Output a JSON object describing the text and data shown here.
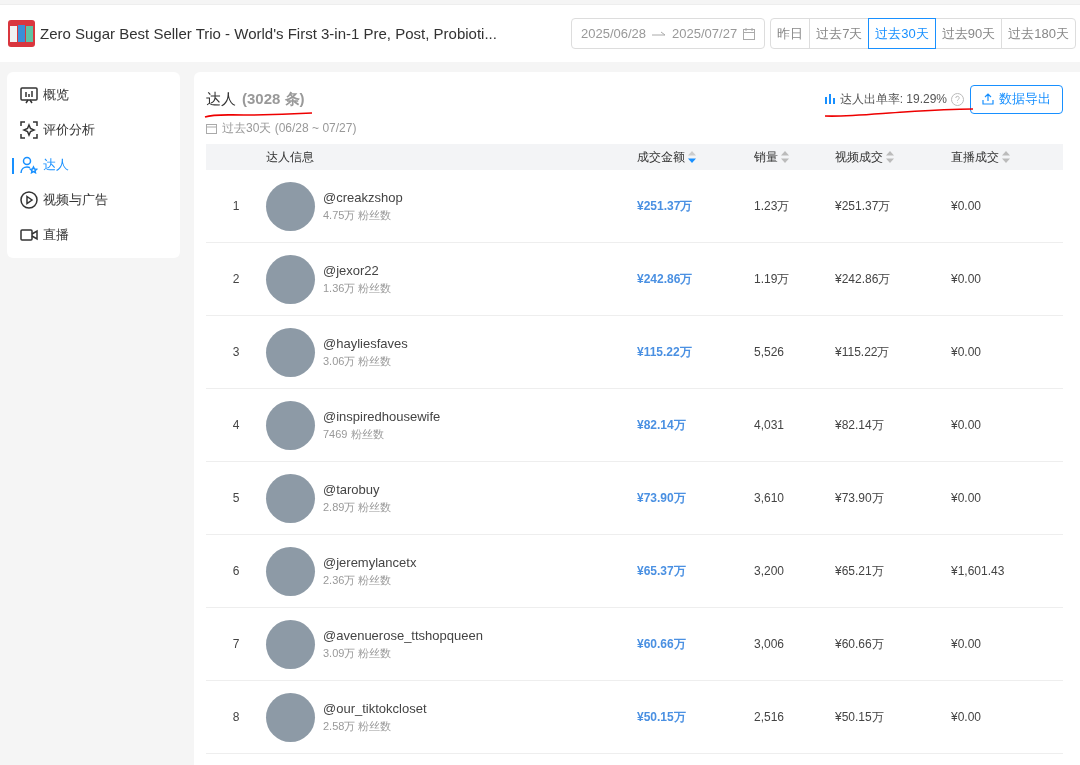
{
  "header": {
    "product_title": "Zero Sugar Best Seller Trio - World's First 3-in-1 Pre, Post, Probioti...",
    "date_range": {
      "start": "2025/06/28",
      "end": "2025/07/27"
    },
    "periods": [
      {
        "label": "昨日",
        "selected": false
      },
      {
        "label": "过去7天",
        "selected": false
      },
      {
        "label": "过去30天",
        "selected": true
      },
      {
        "label": "过去90天",
        "selected": false
      },
      {
        "label": "过去180天",
        "selected": false
      }
    ]
  },
  "sidebar": {
    "items": [
      {
        "label": "概览",
        "kind": "overview",
        "selected": false
      },
      {
        "label": "评价分析",
        "kind": "review",
        "selected": false
      },
      {
        "label": "达人",
        "kind": "creator",
        "selected": true
      },
      {
        "label": "视频与广告",
        "kind": "video",
        "selected": false
      },
      {
        "label": "直播",
        "kind": "live",
        "selected": false
      }
    ]
  },
  "panel": {
    "title": "达人",
    "count": "(3028 条)",
    "period_note": "过去30天 (06/28 ~ 07/27)",
    "rate": "达人出单率: 19.29%",
    "export_button": "数据导出",
    "table": {
      "columns": [
        {
          "label": "达人信息",
          "kind": "plain"
        },
        {
          "label": "成交金额",
          "kind": "sortable",
          "sorted": true
        },
        {
          "label": "销量",
          "kind": "sortable",
          "sorted": false
        },
        {
          "label": "视频成交",
          "kind": "sortable",
          "sorted": false
        },
        {
          "label": "直播成交",
          "kind": "sortable",
          "sorted": false
        }
      ],
      "rows": [
        {
          "rank": "1",
          "handle": "@creakzshop",
          "followers": "4.75万 粉丝数",
          "amount": "¥251.37万",
          "sales": "1.23万",
          "video": "¥251.37万",
          "live": "¥0.00"
        },
        {
          "rank": "2",
          "handle": "@jexor22",
          "followers": "1.36万 粉丝数",
          "amount": "¥242.86万",
          "sales": "1.19万",
          "video": "¥242.86万",
          "live": "¥0.00"
        },
        {
          "rank": "3",
          "handle": "@hayliesfaves",
          "followers": "3.06万 粉丝数",
          "amount": "¥115.22万",
          "sales": "5,526",
          "video": "¥115.22万",
          "live": "¥0.00"
        },
        {
          "rank": "4",
          "handle": "@inspiredhousewife",
          "followers": "7469 粉丝数",
          "amount": "¥82.14万",
          "sales": "4,031",
          "video": "¥82.14万",
          "live": "¥0.00"
        },
        {
          "rank": "5",
          "handle": "@tarobuy",
          "followers": "2.89万 粉丝数",
          "amount": "¥73.90万",
          "sales": "3,610",
          "video": "¥73.90万",
          "live": "¥0.00"
        },
        {
          "rank": "6",
          "handle": "@jeremylancetx",
          "followers": "2.36万 粉丝数",
          "amount": "¥65.37万",
          "sales": "3,200",
          "video": "¥65.21万",
          "live": "¥1,601.43"
        },
        {
          "rank": "7",
          "handle": "@avenuerose_ttshopqueen",
          "followers": "3.09万 粉丝数",
          "amount": "¥60.66万",
          "sales": "3,006",
          "video": "¥60.66万",
          "live": "¥0.00"
        },
        {
          "rank": "8",
          "handle": "@our_tiktokcloset",
          "followers": "2.58万 粉丝数",
          "amount": "¥50.15万",
          "sales": "2,516",
          "video": "¥50.15万",
          "live": "¥0.00"
        }
      ]
    }
  }
}
